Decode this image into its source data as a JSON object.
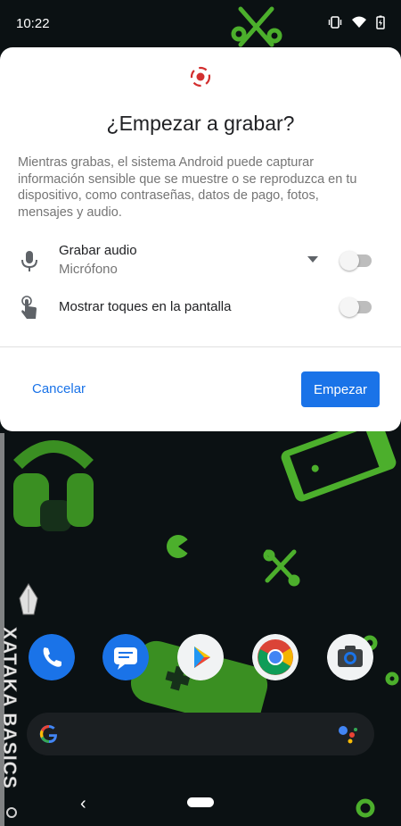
{
  "status_bar": {
    "time": "10:22",
    "icons": [
      "vibrate-icon",
      "wifi-icon",
      "battery-charging-icon"
    ]
  },
  "dialog": {
    "icon": "record-icon",
    "accent_color": "#d32f2f",
    "title": "¿Empezar a grabar?",
    "description": "Mientras grabas, el sistema Android puede capturar información sensible que se muestre o se reproduzca en tu dispositivo, como contraseñas, datos de pago, fotos, mensajes y audio.",
    "options": [
      {
        "icon": "microphone-icon",
        "label": "Grabar audio",
        "sublabel": "Micrófono",
        "has_dropdown": true,
        "enabled": false
      },
      {
        "icon": "touch-icon",
        "label": "Mostrar toques en la pantalla",
        "enabled": false
      }
    ],
    "cancel_label": "Cancelar",
    "start_label": "Empezar",
    "button_color": "#1a73e8"
  },
  "home_screen": {
    "watermark": "XATAKA BASICS",
    "dock_apps": [
      "phone-icon",
      "messages-icon",
      "play-store-icon",
      "chrome-icon",
      "camera-icon"
    ],
    "search_bar_icons": [
      "google-g-icon",
      "assistant-icon"
    ]
  },
  "nav_bar": {
    "icons": [
      "back-icon",
      "home-pill-icon"
    ]
  }
}
